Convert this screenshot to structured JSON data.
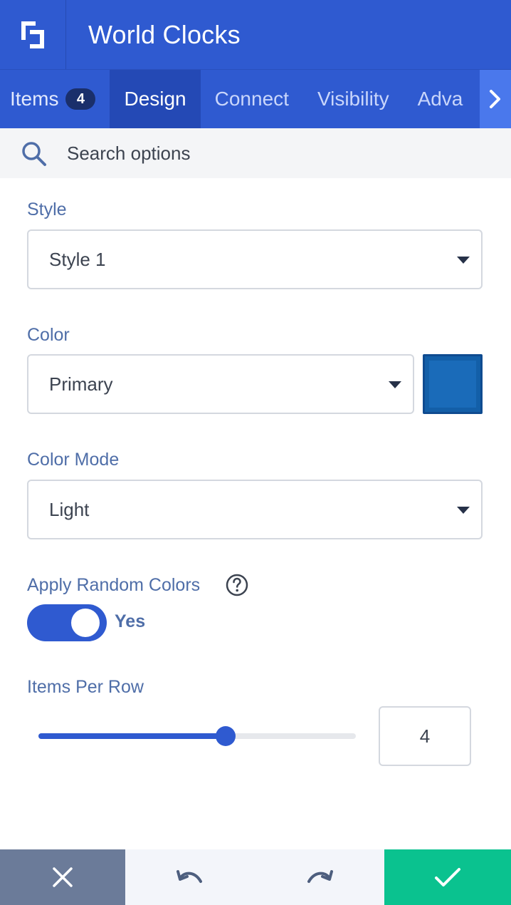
{
  "header": {
    "title": "World Clocks",
    "logo_icon": "logo-icon"
  },
  "tabs": [
    {
      "label": "Items",
      "badge": "4",
      "active": false
    },
    {
      "label": "Design",
      "active": true
    },
    {
      "label": "Connect",
      "active": false
    },
    {
      "label": "Visibility",
      "active": false
    },
    {
      "label": "Adva",
      "active": false
    }
  ],
  "search": {
    "placeholder": "Search options",
    "value": ""
  },
  "fields": {
    "style": {
      "label": "Style",
      "value": "Style 1"
    },
    "color": {
      "label": "Color",
      "value": "Primary",
      "swatch_color": "#1a6bb9"
    },
    "color_mode": {
      "label": "Color Mode",
      "value": "Light"
    },
    "random_colors": {
      "label": "Apply Random Colors",
      "state_text": "Yes",
      "enabled": true
    },
    "items_per_row": {
      "label": "Items Per Row",
      "value": "4",
      "level": 0.59
    }
  },
  "colors": {
    "accent": "#2f5ad0",
    "confirm": "#0ac28f",
    "cancel": "#6b7b99",
    "label": "#4f6ea8"
  },
  "footer": {
    "cancel_icon": "close-icon",
    "undo_icon": "undo-icon",
    "redo_icon": "redo-icon",
    "confirm_icon": "check-icon"
  }
}
